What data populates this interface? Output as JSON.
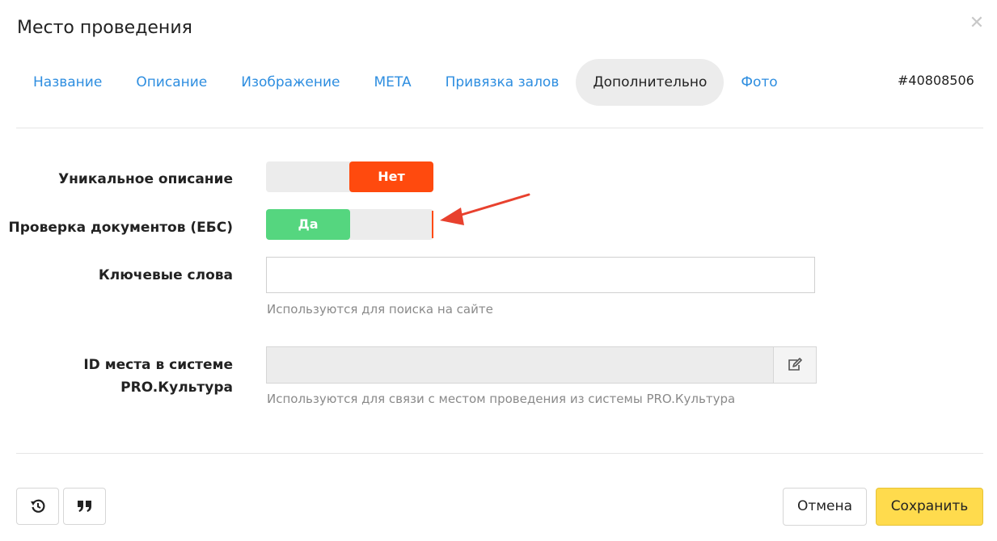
{
  "modal": {
    "title": "Место проведения",
    "close_icon": "close-icon",
    "record_id": "#40808506"
  },
  "tabs": [
    {
      "label": "Название",
      "active": false
    },
    {
      "label": "Описание",
      "active": false
    },
    {
      "label": "Изображение",
      "active": false
    },
    {
      "label": "META",
      "active": false
    },
    {
      "label": "Привязка залов",
      "active": false
    },
    {
      "label": "Дополнительно",
      "active": true
    },
    {
      "label": "Фото",
      "active": false
    }
  ],
  "form": {
    "unique_description": {
      "label": "Уникальное описание",
      "value": "Нет",
      "color": "#ff4a0e"
    },
    "documents_check": {
      "label": "Проверка документов (ЕБС)",
      "value": "Да",
      "color": "#55d67f"
    },
    "keywords": {
      "label": "Ключевые слова",
      "value": "",
      "hint": "Используются для поиска на сайте"
    },
    "pro_culture_id": {
      "label_line1": "ID места в системе",
      "label_line2": "PRO.Культура",
      "value": "",
      "hint": "Используются для связи с местом проведения из системы PRO.Культура",
      "edit_icon": "edit-icon"
    }
  },
  "footer": {
    "history_icon": "history-icon",
    "quote_icon": "quote-icon",
    "cancel_label": "Отмена",
    "save_label": "Сохранить",
    "save_color": "#ffdb4d"
  },
  "annotation": {
    "arrow_color": "#e8412e"
  }
}
